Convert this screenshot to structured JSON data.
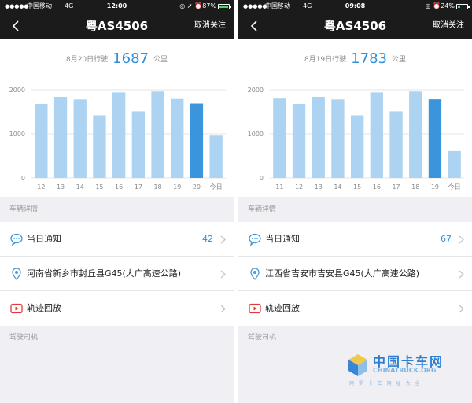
{
  "colors": {
    "accent": "#2e8fdc",
    "bar_light": "#acd3f1",
    "bar_selected": "#3a95dd",
    "nav_background": "#1b1b1b",
    "page_background": "#efeff4"
  },
  "screens": [
    {
      "status_bar": {
        "signal": "●●●●●",
        "carrier": "中国移动",
        "network": "4G",
        "time": "12:00",
        "icons": "◎ ➚ ⏰",
        "battery": "87%",
        "battery_level": 0.87
      },
      "nav": {
        "back_icon": "chevron-left-icon",
        "title": "粤AS4506",
        "action_label": "取消关注"
      },
      "summary": {
        "date_label": "8月20日行驶",
        "distance": "1687",
        "unit": "公里"
      },
      "chart_data": {
        "type": "bar",
        "categories": [
          "12",
          "13",
          "14",
          "15",
          "16",
          "17",
          "18",
          "19",
          "20",
          "今日"
        ],
        "values": [
          1680,
          1840,
          1780,
          1420,
          1940,
          1510,
          1960,
          1790,
          1687,
          960
        ],
        "highlight_index": 8,
        "y_ticks": [
          "0",
          "1000",
          "2000"
        ],
        "ylim": [
          0,
          2000
        ],
        "grid": true
      },
      "sections": {
        "vehicle_details": "车辆详情",
        "driver": "驾驶司机"
      },
      "rows": [
        {
          "icon": "chat-bubble-icon",
          "label": "当日通知",
          "count": "42"
        },
        {
          "icon": "location-pin-icon",
          "label": "河南省新乡市封丘县G45(大广高速公路)"
        },
        {
          "icon": "play-video-icon",
          "label": "轨迹回放"
        }
      ]
    },
    {
      "status_bar": {
        "signal": "●●●●●",
        "carrier": "中国移动",
        "network": "4G",
        "time": "09:08",
        "icons": "◎ ⏰",
        "battery": "24%",
        "battery_level": 0.24
      },
      "nav": {
        "back_icon": "chevron-left-icon",
        "title": "粤AS4506",
        "action_label": "取消关注"
      },
      "summary": {
        "date_label": "8月19日行驶",
        "distance": "1783",
        "unit": "公里"
      },
      "chart_data": {
        "type": "bar",
        "categories": [
          "11",
          "12",
          "13",
          "14",
          "15",
          "16",
          "17",
          "18",
          "19",
          "今日"
        ],
        "values": [
          1800,
          1680,
          1840,
          1780,
          1420,
          1940,
          1510,
          1960,
          1783,
          610
        ],
        "highlight_index": 8,
        "y_ticks": [
          "0",
          "1000",
          "2000"
        ],
        "ylim": [
          0,
          2000
        ],
        "grid": true
      },
      "sections": {
        "vehicle_details": "车辆详情",
        "driver": "驾驶司机"
      },
      "rows": [
        {
          "icon": "chat-bubble-icon",
          "label": "当日通知",
          "count": "67"
        },
        {
          "icon": "location-pin-icon",
          "label": "江西省吉安市吉安县G45(大广高速公路)"
        },
        {
          "icon": "play-video-icon",
          "label": "轨迹回放"
        }
      ]
    }
  ],
  "watermark": {
    "name_cn": "中国卡车网",
    "name_en": "CHINATRUCK.ORG",
    "tagline": "网 罗 卡 车 网 址 大 全"
  }
}
